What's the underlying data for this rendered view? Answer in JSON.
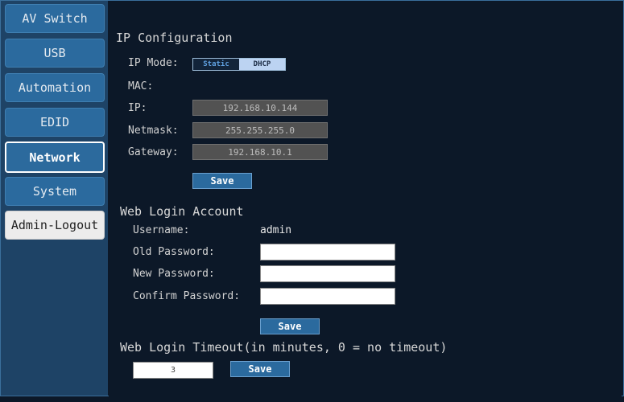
{
  "sidebar": {
    "items": [
      {
        "label": "AV Switch"
      },
      {
        "label": "USB"
      },
      {
        "label": "Automation"
      },
      {
        "label": "EDID"
      },
      {
        "label": "Network"
      },
      {
        "label": "System"
      },
      {
        "label": "Admin-Logout"
      }
    ],
    "active": "Network"
  },
  "ip_config": {
    "title": "IP Configuration",
    "mode_label": "IP Mode:",
    "mode_options": [
      "Static",
      "DHCP"
    ],
    "mode_selected": "DHCP",
    "mac_label": "MAC:",
    "ip_label": "IP:",
    "ip_value": "192.168.10.144",
    "netmask_label": "Netmask:",
    "netmask_value": "255.255.255.0",
    "gateway_label": "Gateway:",
    "gateway_value": "192.168.10.1",
    "save_label": "Save"
  },
  "web_login": {
    "title": "Web Login Account",
    "username_label": "Username:",
    "username_value": "admin",
    "old_password_label": "Old Password:",
    "new_password_label": "New Password:",
    "confirm_password_label": "Confirm Password:",
    "save_label": "Save"
  },
  "timeout": {
    "title": "Web Login Timeout(in minutes, 0 = no timeout)",
    "value": "3",
    "save_label": "Save"
  },
  "colors": {
    "background": "#0c1828",
    "sidebar": "#1e4366",
    "button": "#2b6a9e",
    "readonly_field": "#525252"
  }
}
